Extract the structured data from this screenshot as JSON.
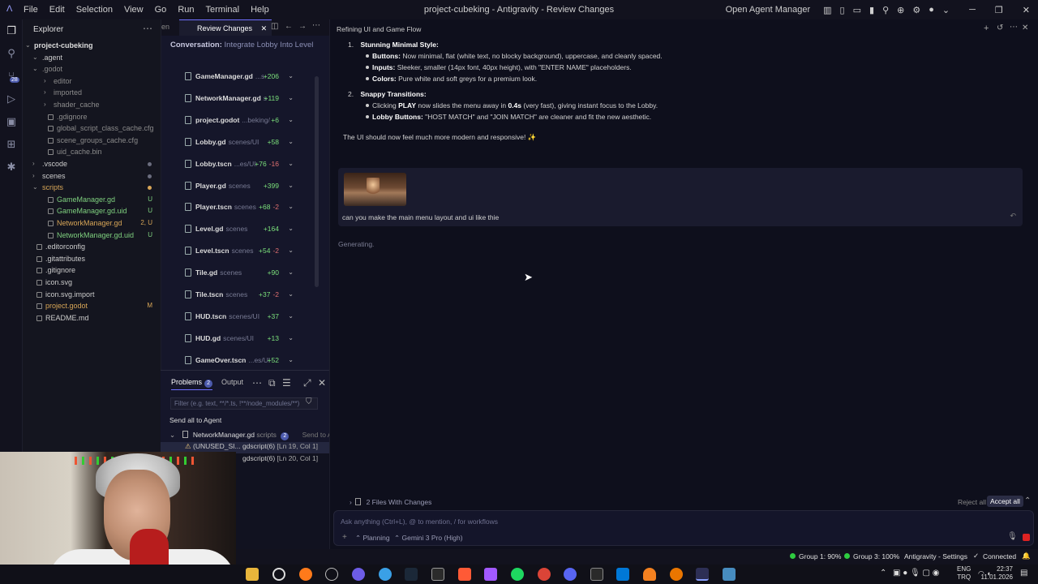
{
  "titlebar": {
    "menu": [
      "File",
      "Edit",
      "Selection",
      "View",
      "Go",
      "Run",
      "Terminal",
      "Help"
    ],
    "window_title": "project-cubeking - Antigravity - Review Changes",
    "open_agent_manager": "Open Agent Manager"
  },
  "explorer": {
    "header": "Explorer",
    "root": "project-cubeking",
    "items": [
      {
        "label": ".agent",
        "type": "folder",
        "depth": 1,
        "open": true,
        "color": "#cccccc"
      },
      {
        "label": ".godot",
        "type": "folder",
        "depth": 1,
        "open": true,
        "color": "#8b8b8b"
      },
      {
        "label": "editor",
        "type": "folder",
        "depth": 2,
        "open": false,
        "color": "#8b8b8b"
      },
      {
        "label": "imported",
        "type": "folder",
        "depth": 2,
        "open": false,
        "color": "#8b8b8b"
      },
      {
        "label": "shader_cache",
        "type": "folder",
        "depth": 2,
        "open": false,
        "color": "#8b8b8b"
      },
      {
        "label": ".gdignore",
        "type": "file",
        "depth": 2,
        "color": "#8b8b8b"
      },
      {
        "label": "global_script_class_cache.cfg",
        "type": "file",
        "depth": 2,
        "color": "#8b8b8b"
      },
      {
        "label": "scene_groups_cache.cfg",
        "type": "file",
        "depth": 2,
        "color": "#8b8b8b"
      },
      {
        "label": "uid_cache.bin",
        "type": "file",
        "depth": 2,
        "color": "#8b8b8b"
      },
      {
        "label": ".vscode",
        "type": "folder",
        "depth": 1,
        "open": false,
        "color": "#cccccc"
      },
      {
        "label": "scenes",
        "type": "folder",
        "depth": 1,
        "open": false,
        "color": "#cccccc"
      },
      {
        "label": "scripts",
        "type": "folder",
        "depth": 1,
        "open": true,
        "color": "#d8a657"
      },
      {
        "label": "GameManager.gd",
        "type": "file",
        "depth": 2,
        "color": "#7fd17f",
        "status": "U"
      },
      {
        "label": "GameManager.gd.uid",
        "type": "file",
        "depth": 2,
        "color": "#7fd17f",
        "status": "U"
      },
      {
        "label": "NetworkManager.gd",
        "type": "file",
        "depth": 2,
        "color": "#d8a657",
        "status": "2, U"
      },
      {
        "label": "NetworkManager.gd.uid",
        "type": "file",
        "depth": 2,
        "color": "#7fd17f",
        "status": "U"
      },
      {
        "label": ".editorconfig",
        "type": "file",
        "depth": 1,
        "color": "#cccccc"
      },
      {
        "label": ".gitattributes",
        "type": "file",
        "depth": 1,
        "color": "#cccccc"
      },
      {
        "label": ".gitignore",
        "type": "file",
        "depth": 1,
        "color": "#cccccc"
      },
      {
        "label": "icon.svg",
        "type": "file",
        "depth": 1,
        "color": "#cccccc"
      },
      {
        "label": "icon.svg.import",
        "type": "file",
        "depth": 1,
        "color": "#cccccc"
      },
      {
        "label": "project.godot",
        "type": "file",
        "depth": 1,
        "color": "#d8a657",
        "status": "M"
      },
      {
        "label": "README.md",
        "type": "file",
        "depth": 1,
        "color": "#cccccc"
      }
    ]
  },
  "review": {
    "tab_partial": "en",
    "tab_label": "Review Changes",
    "conversation_prefix": "Conversation:",
    "conversation_title": "Integrate Lobby Into Level",
    "files": [
      {
        "name": "GameManager.gd",
        "dir": "...s",
        "add": "+206",
        "del": ""
      },
      {
        "name": "NetworkManager.gd",
        "dir": "s",
        "add": "+119",
        "del": ""
      },
      {
        "name": "project.godot",
        "dir": "...beking/",
        "add": "+6",
        "del": ""
      },
      {
        "name": "Lobby.gd",
        "dir": "scenes/UI",
        "add": "+58",
        "del": ""
      },
      {
        "name": "Lobby.tscn",
        "dir": "...es/UI",
        "add": "+76",
        "del": "-16"
      },
      {
        "name": "Player.gd",
        "dir": "scenes",
        "add": "+399",
        "del": ""
      },
      {
        "name": "Player.tscn",
        "dir": "scenes",
        "add": "+68",
        "del": "-2"
      },
      {
        "name": "Level.gd",
        "dir": "scenes",
        "add": "+164",
        "del": ""
      },
      {
        "name": "Level.tscn",
        "dir": "scenes",
        "add": "+54",
        "del": "-2"
      },
      {
        "name": "Tile.gd",
        "dir": "scenes",
        "add": "+90",
        "del": ""
      },
      {
        "name": "Tile.tscn",
        "dir": "scenes",
        "add": "+37",
        "del": "-2"
      },
      {
        "name": "HUD.tscn",
        "dir": "scenes/UI",
        "add": "+37",
        "del": ""
      },
      {
        "name": "HUD.gd",
        "dir": "scenes/UI",
        "add": "+13",
        "del": ""
      },
      {
        "name": "GameOver.tscn",
        "dir": "...es/UI",
        "add": "+52",
        "del": ""
      }
    ]
  },
  "problems": {
    "tab_problems": "Problems",
    "count": "2",
    "tab_output": "Output",
    "filter_placeholder": "Filter (e.g. text, **/*.ts, !**/node_modules/**)",
    "send_all": "Send all to Agent",
    "file": "NetworkManager.gd",
    "file_dir": "scripts",
    "file_count": "2",
    "send_to_agent": "Send to Agen",
    "rows": [
      {
        "code": "(UNUSED_SI...",
        "source": "gdscript(6)",
        "loc": "[Ln 19, Col 1]"
      },
      {
        "code": "",
        "source": "gdscript(6)",
        "loc": "[Ln 20, Col 1]"
      }
    ]
  },
  "chat": {
    "title": "Refining UI and Game Flow",
    "item1_num": "1.",
    "item1_title": "Stunning Minimal Style:",
    "b1_key": "Buttons:",
    "b1_text": "Now minimal, flat (white text, no blocky background), uppercase, and cleanly spaced.",
    "b2_key": "Inputs:",
    "b2_text": "Sleeker, smaller (14px font, 40px height), with \"ENTER NAME\" placeholders.",
    "b3_key": "Colors:",
    "b3_text": "Pure white and soft greys for a premium look.",
    "item2_num": "2.",
    "item2_title": "Snappy Transitions:",
    "b4_pre": "Clicking",
    "b4_key": "PLAY",
    "b4_mid": "now slides the menu away in",
    "b4_key2": "0.4s",
    "b4_post": "(very fast), giving instant focus to the Lobby.",
    "b5_key": "Lobby Buttons:",
    "b5_text": "\"HOST MATCH\" and \"JOIN MATCH\" are cleaner and fit the new aesthetic.",
    "summary": "The UI should now feel much more modern and responsive! ✨",
    "user_message": "can you make the main menu layout and ui like thie",
    "generating": "Generating.",
    "files_changed": "2 Files With Changes",
    "reject_all": "Reject all",
    "accept_all": "Accept all",
    "input_placeholder": "Ask anything (Ctrl+L), @ to mention, / for workflows",
    "mode": "Planning",
    "model": "Gemini 3 Pro (High)"
  },
  "statusbar": {
    "group1": "Group 1: 90%",
    "group3": "Group 3: 100%",
    "settings": "Antigravity - Settings",
    "connected": "Connected",
    "group1_color": "#2ecc40",
    "group3_color": "#2ecc40"
  },
  "taskbar": {
    "lang1": "ENG",
    "lang2": "TRQ",
    "time": "22:37",
    "date": "11.01.2026"
  },
  "activity": {
    "scm_badge": "28"
  }
}
